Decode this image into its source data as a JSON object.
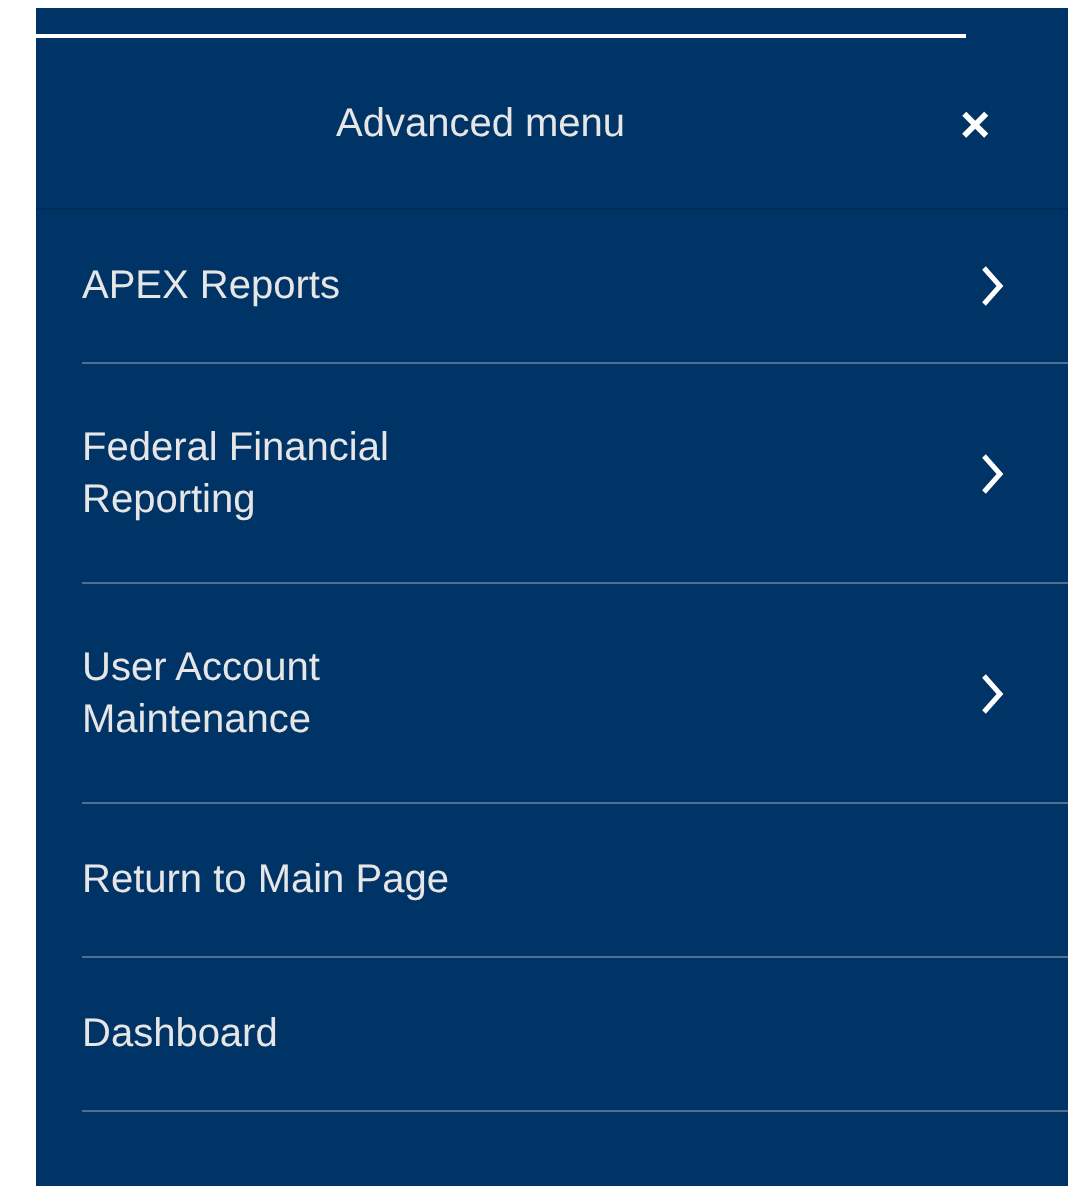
{
  "menu": {
    "title": "Advanced menu",
    "close": "×",
    "items": [
      {
        "label": "APEX Reports",
        "submenu": true
      },
      {
        "label": "Federal Financial\nReporting",
        "submenu": true
      },
      {
        "label": "User Account\nMaintenance",
        "submenu": true
      },
      {
        "label": "Return to Main Page",
        "submenu": false
      },
      {
        "label": "Dashboard",
        "submenu": false
      }
    ]
  }
}
